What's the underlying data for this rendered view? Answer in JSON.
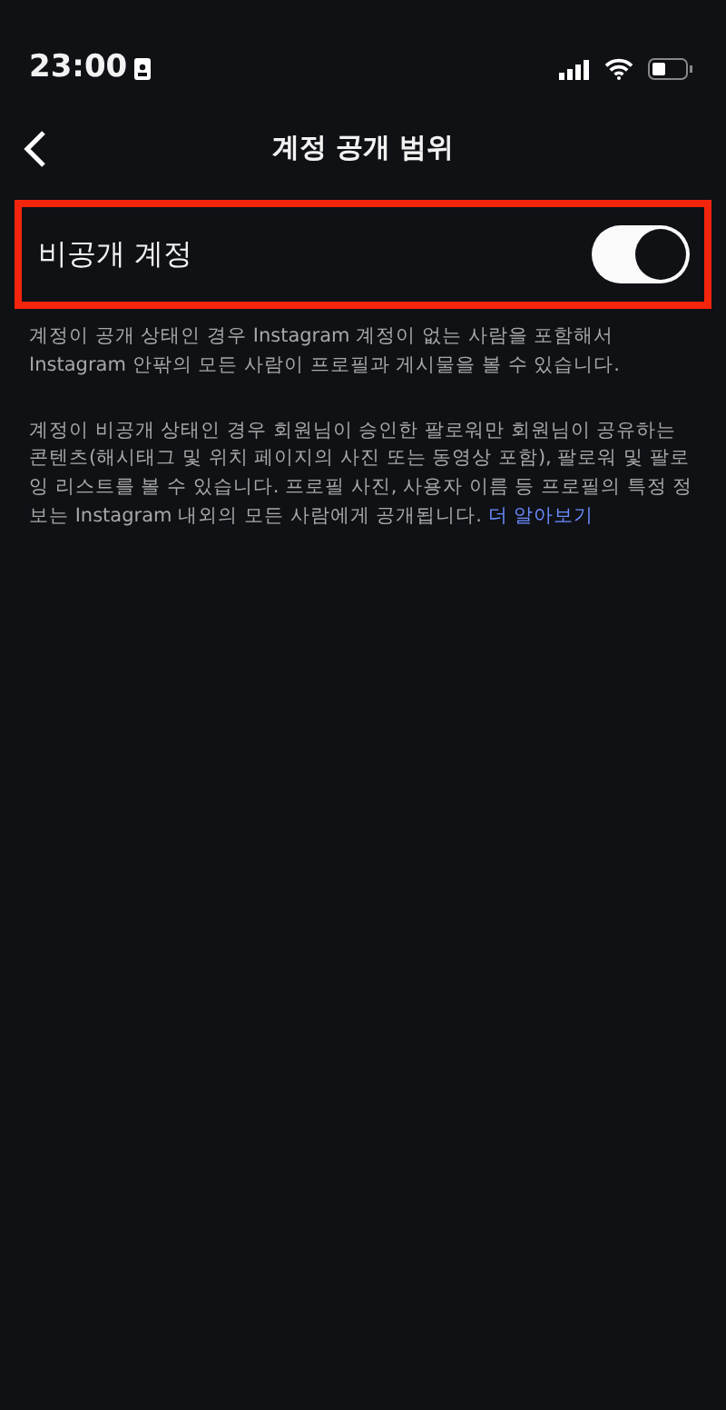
{
  "status_bar": {
    "time": "23:00"
  },
  "header": {
    "title": "계정 공개 범위"
  },
  "setting": {
    "label": "비공개 계정",
    "on": true,
    "highlighted": true
  },
  "descriptions": [
    {
      "text": "계정이 공개 상태인 경우 Instagram 계정이 없는 사람을 포함해서 Instagram 안팎의 모든 사람이 프로필과 게시물을 볼 수 있습니다."
    },
    {
      "text": "계정이 비공개 상태인 경우 회원님이 승인한 팔로워만 회원님이 공유하는 콘텐츠(해시태그 및 위치 페이지의 사진 또는 동영상 포함), 팔로워 및 팔로잉 리스트를 볼 수 있습니다. 프로필 사진, 사용자 이름 등 프로필의 특정 정보는 Instagram 내외의 모든 사람에게 공개됩니다.",
      "link": "더 알아보기"
    }
  ]
}
